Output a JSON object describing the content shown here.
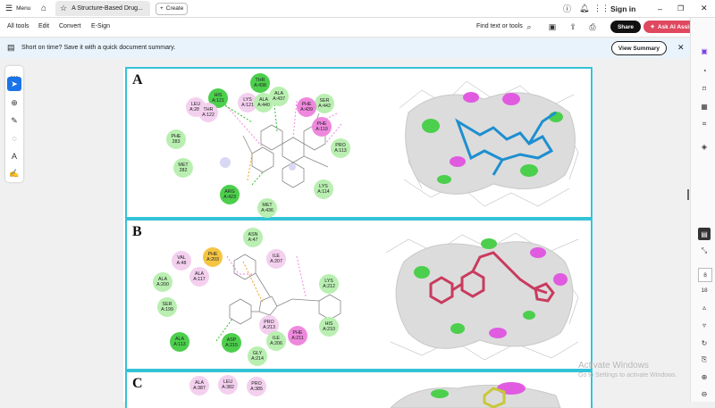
{
  "tabstrip": {
    "menu_label": "Menu",
    "tab_title": "A Structure-Based Drug...",
    "create_label": "Create",
    "sign_in": "Sign in"
  },
  "toolbar": {
    "items": [
      "All tools",
      "Edit",
      "Convert",
      "E-Sign"
    ],
    "find_label": "Find text or tools",
    "share_label": "Share",
    "ai_label": "Ask AI Assistant"
  },
  "notice": {
    "text": "Short on time? Save it with a quick document summary.",
    "button": "View Summary"
  },
  "right_rail": {
    "page_number": "8",
    "page_total": "18"
  },
  "figure": {
    "panels": [
      {
        "label": "A",
        "residues": [
          {
            "name": "HIS",
            "id": "A:121"
          },
          {
            "name": "THR",
            "id": "A:438"
          },
          {
            "name": "LEU",
            "id": "A:284"
          },
          {
            "name": "THR",
            "id": "A:122"
          },
          {
            "name": "LYS",
            "id": "A:121"
          },
          {
            "name": "ALA",
            "id": "A:440"
          },
          {
            "name": "ALA",
            "id": "A:437"
          },
          {
            "name": "SER",
            "id": "A:442"
          },
          {
            "name": "PHE",
            "id": "A:439"
          },
          {
            "name": "PHE",
            "id": "A:119"
          },
          {
            "name": "PHE",
            "id": "283"
          },
          {
            "name": "PRO",
            "id": "A:113"
          },
          {
            "name": "MET",
            "id": "282"
          },
          {
            "name": "LYS",
            "id": "A:114"
          },
          {
            "name": "ARG",
            "id": "A:423"
          },
          {
            "name": "MET",
            "id": "A:436"
          }
        ]
      },
      {
        "label": "B",
        "residues": [
          {
            "name": "ASN",
            "id": "A:47"
          },
          {
            "name": "VAL",
            "id": "A:48"
          },
          {
            "name": "PHE",
            "id": "A:203"
          },
          {
            "name": "ILE",
            "id": "A:207"
          },
          {
            "name": "ALA",
            "id": "A:117"
          },
          {
            "name": "ALA",
            "id": "A:200"
          },
          {
            "name": "LYS",
            "id": "A:212"
          },
          {
            "name": "SER",
            "id": "A:199"
          },
          {
            "name": "PRO",
            "id": "A:213"
          },
          {
            "name": "HIS",
            "id": "A:210"
          },
          {
            "name": "ALA",
            "id": "A:113"
          },
          {
            "name": "ASP",
            "id": "A:215"
          },
          {
            "name": "ILE",
            "id": "A:206"
          },
          {
            "name": "PHE",
            "id": "A:211"
          },
          {
            "name": "GLY",
            "id": "A:214"
          }
        ]
      },
      {
        "label": "C",
        "residues": [
          {
            "name": "ALA",
            "id": "A:387"
          },
          {
            "name": "LEU",
            "id": "A:382"
          },
          {
            "name": "PRO",
            "id": "A:385"
          }
        ]
      }
    ]
  },
  "watermark": {
    "line1": "Activate Windows",
    "line2": "Go to Settings to activate Windows."
  }
}
